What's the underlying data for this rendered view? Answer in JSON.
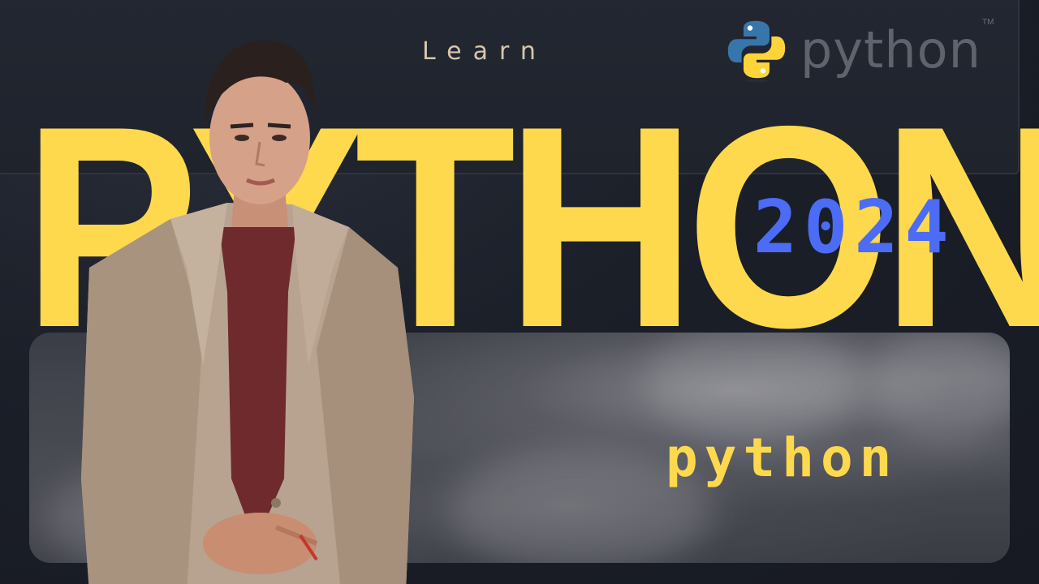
{
  "thumbnail": {
    "learn_label": "Learn",
    "big_title": "PYTHON",
    "year": "2024",
    "sub_word": "python"
  },
  "logo": {
    "wordmark": "python",
    "trademark": "TM",
    "icon": "python-logo-icon"
  },
  "colors": {
    "background": "#1a1e27",
    "title_yellow": "#ffd94d",
    "year_blue": "#4c6cf5",
    "learn_text": "#d7c7ae",
    "logo_gray": "#5f636b",
    "python_blue": "#3776ab",
    "python_yellow": "#ffd43b"
  },
  "person": {
    "icon": "presenter-photo"
  }
}
